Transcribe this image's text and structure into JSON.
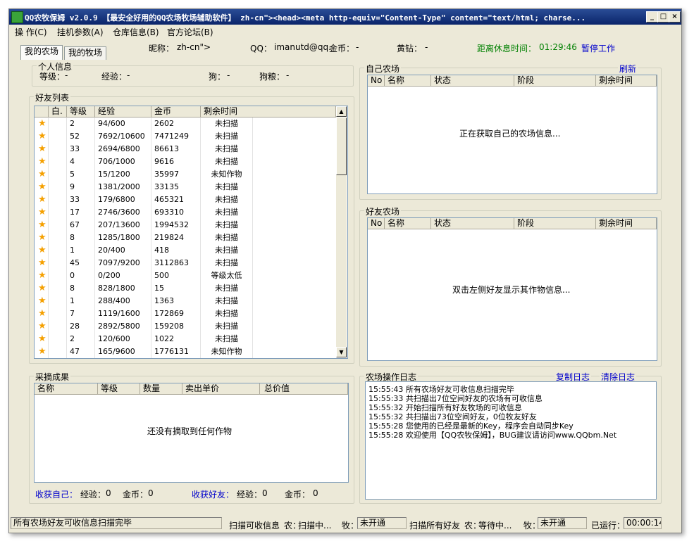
{
  "window": {
    "title": "QQ农牧保姆 v2.0.9 【最安全好用的QQ农场牧场辅助软件】 zh-cn\"><head><meta http-equiv=\"Content-Type\" content=\"text/html; charse...",
    "buttons": {
      "minimize": "_",
      "maximize": "□",
      "close": "×"
    }
  },
  "menu": [
    "操 作(C)",
    "挂机参数(A)",
    "仓库信息(B)",
    "官方论坛(B)"
  ],
  "tabs": [
    "我的农场",
    "我的牧场"
  ],
  "header": {
    "nickname_label": "昵称：",
    "nickname_value": "zh-cn\">",
    "qq_label": "QQ：",
    "qq_value": "imanutd@qq.",
    "gold_label": "金币：",
    "gold_value": "-",
    "diamond_label": "黄钻：",
    "diamond_value": "-",
    "rest_label": "距离休息时间：",
    "rest_value": "01:29:46",
    "pause_link": "暂停工作"
  },
  "personal": {
    "title": "个人信息",
    "level_label": "等级：",
    "level_value": "-",
    "exp_label": "经验：",
    "exp_value": "-",
    "dog_label": "狗：",
    "dog_value": "-",
    "dogfood_label": "狗粮：",
    "dogfood_value": "-"
  },
  "friends": {
    "title": "好友列表",
    "columns": [
      "",
      "白.",
      "等级",
      "经验",
      "金币",
      "剩余时间"
    ],
    "rows": [
      [
        "2",
        "94/600",
        "2602",
        "未扫描"
      ],
      [
        "52",
        "7692/10600",
        "7471249",
        "未扫描"
      ],
      [
        "33",
        "2694/6800",
        "86613",
        "未扫描"
      ],
      [
        "4",
        "706/1000",
        "9616",
        "未扫描"
      ],
      [
        "5",
        "15/1200",
        "35997",
        "未知作物"
      ],
      [
        "9",
        "1381/2000",
        "33135",
        "未扫描"
      ],
      [
        "33",
        "179/6800",
        "465321",
        "未扫描"
      ],
      [
        "17",
        "2746/3600",
        "693310",
        "未扫描"
      ],
      [
        "67",
        "207/13600",
        "1994532",
        "未扫描"
      ],
      [
        "8",
        "1285/1800",
        "219824",
        "未扫描"
      ],
      [
        "1",
        "20/400",
        "418",
        "未扫描"
      ],
      [
        "45",
        "7097/9200",
        "3112863",
        "未扫描"
      ],
      [
        "0",
        "0/200",
        "500",
        "等级太低"
      ],
      [
        "8",
        "828/1800",
        "15",
        "未扫描"
      ],
      [
        "1",
        "288/400",
        "1363",
        "未扫描"
      ],
      [
        "7",
        "1119/1600",
        "172869",
        "未扫描"
      ],
      [
        "28",
        "2892/5800",
        "159208",
        "未扫描"
      ],
      [
        "2",
        "120/600",
        "1022",
        "未扫描"
      ],
      [
        "47",
        "165/9600",
        "1776131",
        "未知作物"
      ]
    ]
  },
  "own_farm": {
    "title": "自己农场",
    "refresh_link": "刷新",
    "columns": [
      "No",
      "名称",
      "状态",
      "阶段",
      "剩余时间"
    ],
    "empty_text": "正在获取自己的农场信息..."
  },
  "friend_farm": {
    "title": "好友农场",
    "columns": [
      "No",
      "名称",
      "状态",
      "阶段",
      "剩余时间"
    ],
    "empty_text": "双击左侧好友显示其作物信息..."
  },
  "harvest": {
    "title": "采摘成果",
    "columns": [
      "名称",
      "等级",
      "数量",
      "卖出单价",
      "总价值"
    ],
    "empty_text": "还没有摘取到任何作物",
    "self_label": "收获自己：",
    "self_exp_label": "经验：",
    "self_exp_value": "0",
    "self_gold_label": "金币：",
    "self_gold_value": "0",
    "friend_label": "收获好友：",
    "friend_exp_label": "经验：",
    "friend_exp_value": "0",
    "friend_gold_label": "金币：",
    "friend_gold_value": "0"
  },
  "log": {
    "title": "农场操作日志",
    "copy_link": "复制日志",
    "clear_link": "清除日志",
    "lines": [
      "15:55:43 所有农场好友可收信息扫描完毕",
      "15:55:33 共扫描出7位空间好友的农场有可收信息",
      "15:55:32 开始扫描所有好友牧场的可收信息",
      "15:55:32 共扫描出73位空间好友，0位牧友好友",
      "15:55:28 您使用的已经是最新的Key，程序会自动同步Key",
      "15:55:28 欢迎使用【QQ农牧保姆】，BUG建议请访问www.QQbm.Net"
    ]
  },
  "status": {
    "message": "所有农场好友可收信息扫描完毕",
    "scan_label": "扫描可收信息",
    "farm_label": "农：",
    "farm_value": "扫描中...",
    "pasture_label": "牧：",
    "pasture_value": "未开通",
    "scan_all_label": "扫描所有好友",
    "farm2_label": "农：",
    "farm2_value": "等待中...",
    "pasture2_label": "牧：",
    "pasture2_value": "未开通",
    "running_label": "已运行：",
    "running_value": "00:00:14"
  },
  "colors": {
    "title_bg": "#0a246a",
    "window_bg": "#ece9d8",
    "link": "#0000cc",
    "timer": "#008000",
    "star": "#f5a000"
  }
}
